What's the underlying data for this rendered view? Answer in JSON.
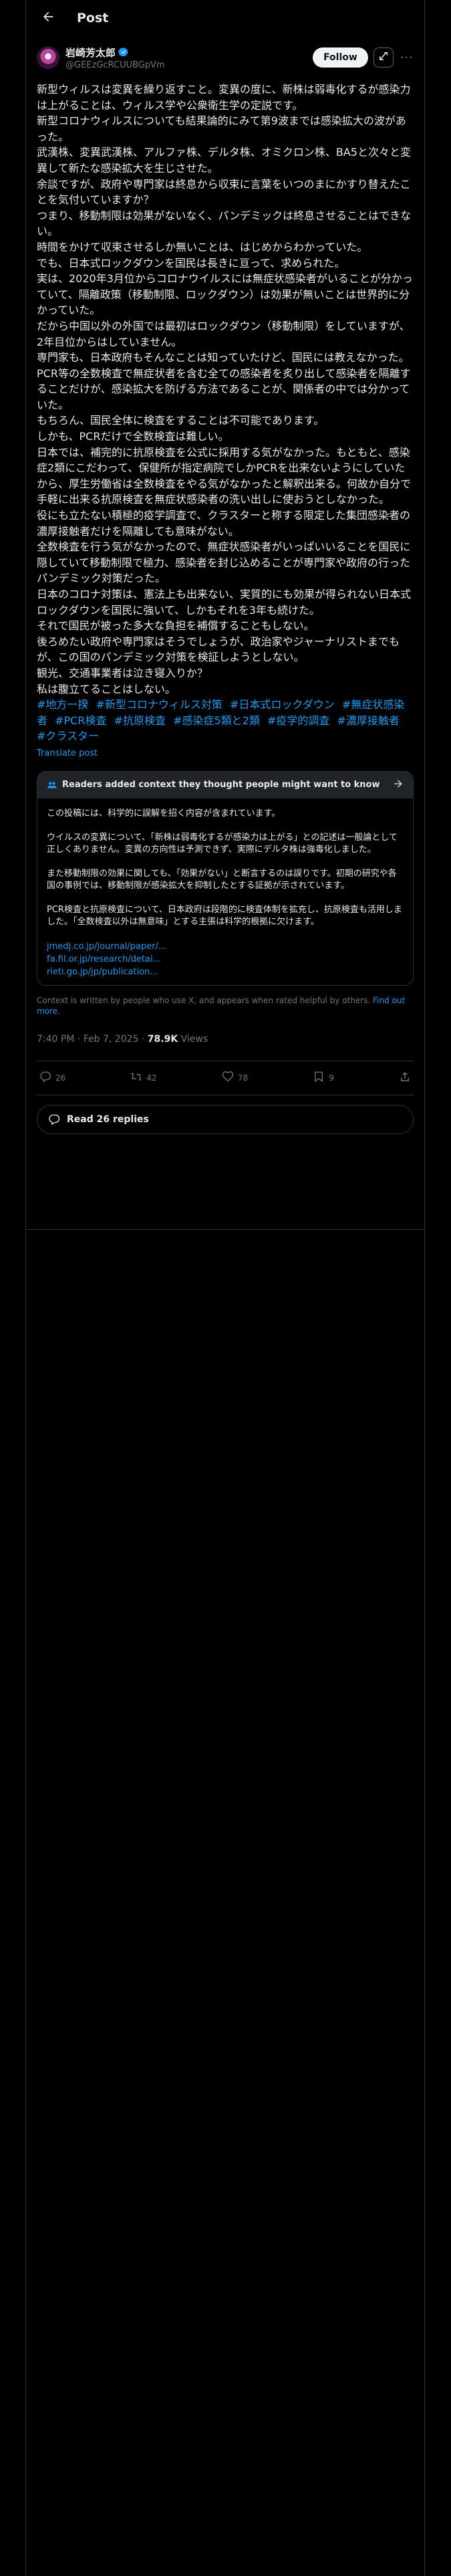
{
  "header": {
    "title": "Post"
  },
  "author": {
    "name": "岩崎芳太郎",
    "handle": "@GEEzGcRCUUBGpVm",
    "follow_label": "Follow",
    "more_label": "···"
  },
  "tweet": {
    "lines": [
      "新型ウィルスは変異を繰り返すこと。変異の度に、新株は弱毒化するが感染力は上がることは、ウィルス学や公衆衛生学の定説です。",
      "新型コロナウィルスについても結果論的にみて第9波までは感染拡大の波があった。",
      "武漢株、変異武漢株、アルファ株、デルタ株、オミクロン株、BA5と次々と変異して新たな感染拡大を生じさせた。",
      "余談ですが、政府や専門家は終息から収束に言葉をいつのまにかすり替えたことを気付いていますか？",
      "つまり、移動制限は効果がないなく、パンデミックは終息させることはできない。",
      "時間をかけて収束させるしか無いことは、はじめからわかっていた。",
      "でも、日本式ロックダウンを国民は長きに亘って、求められた。",
      "実は、2020年3月位からコロナウイルスには無症状感染者がいることが分かっていて、隔離政策（移動制限、ロックダウン）は効果が無いことは世界的に分かっていた。",
      "だから中国以外の外国では最初はロックダウン（移動制限）をしていますが、2年目位からはしていません。",
      "専門家も、日本政府もそんなことは知っていたけど、国民には教えなかった。",
      "PCR等の全数検査で無症状者を含む全ての感染者を炙り出して感染者を隔離することだけが、感染拡大を防げる方法であることが、関係者の中では分かっていた。",
      "もちろん、国民全体に検査をすることは不可能であります。",
      "しかも、PCRだけで全数検査は難しい。",
      "日本では、補完的に抗原検査を公式に採用する気がなかった。もともと、感染症2類にこだわって、保健所が指定病院でしかPCRを出来ないようにしていたから、厚生労働省は全数検査をやる気がなかったと解釈出来る。何故か自分で手軽に出来る抗原検査を無症状感染者の洗い出しに使おうとしなかった。",
      "役にも立たない積極的疫学調査で、クラスターと称する限定した集団感染者の濃厚接触者だけを隔離しても意味がない。",
      "全数検査を行う気がなかったので、無症状感染者がいっぱいいることを国民に隠していて移動制限で極力、感染者を封じ込めることが専門家や政府の行ったパンデミック対策だった。",
      "日本のコロナ対策は、憲法上も出来ない、実質的にも効果が得られない日本式ロックダウンを国民に強いて、しかもそれを3年も続けた。",
      "それで国民が被った多大な負担を補償することもしない。",
      "後ろめたい政府や専門家はそうでしょうが、政治家やジャーナリストまでもが、この国のパンデミック対策を検証しようとしない。",
      "観光、交通事業者は泣き寝入りか？",
      "私は腹立てることはしない。"
    ],
    "hashtags": [
      "#地方一揆",
      "#新型コロナウィルス対策",
      "#日本式ロックダウン",
      "#無症状感染者",
      "#PCR検査",
      "#抗原検査",
      "#感染症5類と2類",
      "#疫学的調査",
      "#濃厚接触者",
      "#クラスター"
    ],
    "translate_label": "Translate post"
  },
  "community_note": {
    "header": "Readers added context they thought people might want to know",
    "paragraphs": [
      "この投稿には、科学的に誤解を招く内容が含まれています。",
      "ウイルスの変異について、「新株は弱毒化するが感染力は上がる」との記述は一般論として正しくありません。変異の方向性は予測できず、実際にデルタ株は強毒化しました。",
      "また移動制限の効果に関しても、「効果がない」と断言するのは誤りです。初期の研究や各国の事例では、移動制限が感染拡大を抑制したとする証拠が示されています。",
      "PCR検査と抗原検査について、日本政府は段階的に検査体制を拡充し、抗原検査も活用しました。「全数検査以外は無意味」とする主張は科学的根拠に欠けます。"
    ],
    "links": [
      "jmedj.co.jp/journal/paper/...",
      "fa.fil.or.jp/research/detai...",
      "rieti.go.jp/jp/publication..."
    ],
    "footer_text": "Context is written by people who use X, and appears when rated helpful by others.",
    "footer_link": "Find out more."
  },
  "meta": {
    "time": "7:40 PM · Feb 7, 2025 · ",
    "views_count": "78.9K",
    "views_label": " Views"
  },
  "actions": {
    "replies": "26",
    "reposts": "42",
    "likes": "78",
    "bookmarks": "9"
  },
  "read_replies_label": "Read 26 replies",
  "colors": {
    "accent": "#1d9bf0",
    "background": "#000000",
    "text": "#e7e9ea",
    "muted": "#71767b",
    "border": "#2f3336"
  }
}
